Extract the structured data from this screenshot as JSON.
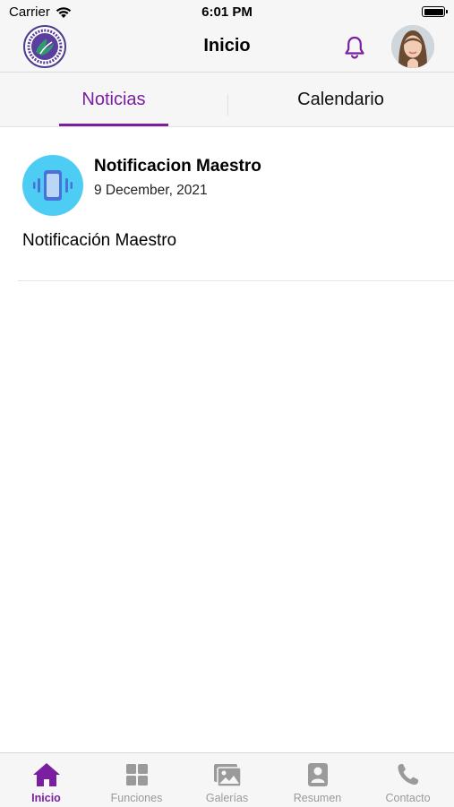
{
  "status_bar": {
    "carrier": "Carrier",
    "time": "6:01 PM"
  },
  "nav": {
    "title": "Inicio"
  },
  "tabs": [
    {
      "label": "Noticias",
      "active": true
    },
    {
      "label": "Calendario",
      "active": false
    }
  ],
  "news": [
    {
      "title": "Notificacion Maestro",
      "date": "9 December, 2021",
      "body": "Notificación Maestro",
      "icon": "phone-vibrate-icon"
    }
  ],
  "tab_bar": [
    {
      "label": "Inicio",
      "icon": "home-icon",
      "active": true
    },
    {
      "label": "Funciones",
      "icon": "grid-icon",
      "active": false
    },
    {
      "label": "Galerías",
      "icon": "gallery-icon",
      "active": false
    },
    {
      "label": "Resumen",
      "icon": "profile-card-icon",
      "active": false
    },
    {
      "label": "Contacto",
      "icon": "phone-icon",
      "active": false
    }
  ],
  "colors": {
    "accent": "#7a1fa0",
    "news_icon_bg": "#4ecdf4",
    "bar_bg": "#f6f6f6",
    "inactive": "#9a9a9a"
  }
}
